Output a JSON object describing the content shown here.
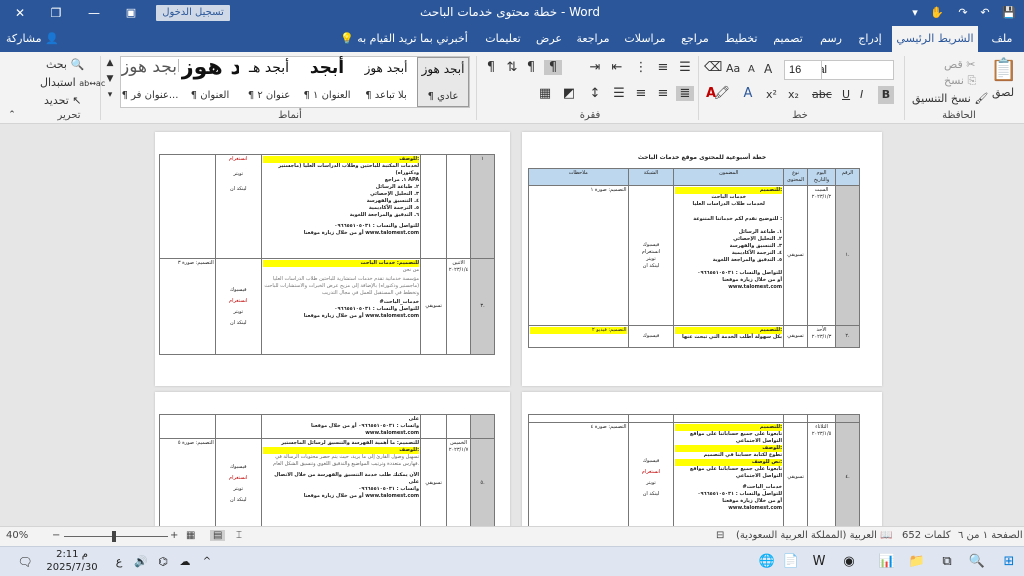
{
  "window": {
    "title": "خطة محتوى خدمات الباحث - Word",
    "signin_label": "تسجيل الدخول",
    "minimize": "—",
    "restore": "❐",
    "close": "✕"
  },
  "tabs": [
    "ملف",
    "الشريط الرئيسي",
    "إدراج",
    "رسم",
    "تصميم",
    "تخطيط",
    "مراجع",
    "مراسلات",
    "مراجعة",
    "عرض",
    "تعليمات"
  ],
  "tell_me": "أخبرني بما تريد القيام به",
  "share_label": "مشاركة",
  "clipboard": {
    "paste": "لصق",
    "cut": "قص",
    "copy": "نسخ",
    "format_painter": "نسخ التنسيق",
    "label": "الحافظة"
  },
  "font": {
    "name": "Arial",
    "size": "16",
    "label": "خط",
    "bold": "B",
    "italic": "I",
    "underline": "U",
    "strike": "abc",
    "sub": "x₂",
    "sup": "x²",
    "aa": "Aa",
    "grow": "A",
    "shrink": "A"
  },
  "paragraph": {
    "label": "فقرة"
  },
  "styles": {
    "label": "أنماط",
    "items": [
      {
        "sample": "أبجد هوز",
        "name": "¶ عادي"
      },
      {
        "sample": "أبجد هوز",
        "name": "¶ بلا تباعد"
      },
      {
        "sample": "أبجد",
        "name": "¶ العنوان ١"
      },
      {
        "sample": "أبجد هـ",
        "name": "¶ عنوان ٢"
      },
      {
        "sample": "أبجد هوز",
        "name": "¶ العنوان"
      },
      {
        "sample": "ابجد هوز",
        "name": "¶ عنوان فر..."
      }
    ]
  },
  "editing": {
    "find": "بحث",
    "replace": "استبدال",
    "select": "تحديد",
    "label": "تحرير"
  },
  "doc": {
    "page_title": "خطة أسبوعية للمحتوى موقع خدمات الباحث",
    "headers": [
      "الرقم",
      "اليوم والتاريخ",
      "نوع المحتوى",
      "المضمون",
      "الشبكة",
      "ملاحظات"
    ],
    "rows": [
      {
        "num": "١.",
        "day": "السبت",
        "date": "٢٠٢٣/١/٢",
        "type": "تسويقي",
        "content": [
          "للتصميم:",
          "خدمات الباحث",
          "لخدمات طلاب الدراسات العليا",
          "للتوضيح نقدم لكم خدماتنا المتنوعة :",
          "١. طباعة الرسائل",
          "٢. التحليل الإحصائي",
          "٣. التنسيق والفهرسة",
          "٤. الترجمة الأكاديمية",
          "٥. التدقيق والمراجعة اللغوية",
          "للتواصل والتساب : ٠٩٦٦٥٥١٠٥٠٣١",
          "أو من خلال زيارة موقعنا www.talomest.com"
        ],
        "networks": [
          "فيسبوك",
          "انستغرام",
          "تويتر",
          "لينكد ان"
        ],
        "notes": "التصميم: صورة ١"
      },
      {
        "num": "٢.",
        "day": "الأحد",
        "date": "٢٠٢٣/١/٣",
        "type": "تسويقي",
        "content": [
          "للتصميم:",
          "بكل سهولة أطلب الخدمة التي تبحث عنها"
        ],
        "networks": [
          "فيسبوك"
        ],
        "notes": "التصميم: فيديو ٢"
      },
      {
        "num": "٣.",
        "day": "الاثنين",
        "date": "٢٠٢٣/١/٤",
        "type": "تسويقي",
        "content": [
          "للتصميم: خدمات الباحث",
          "من نحن",
          "مؤسسة خدماتية تقدم خدمات استشارية للباحثين طلاب الدراسات العليا (ماجستير ودكتوراه) بالإضافة إلى مزيج عرض الخبرات والاستشارات للباحث وتخطط في المستقبل للعمل في مجال التدريب",
          "#خدمات_الباحث",
          "للتواصل والتساب : ٠٩٦٦٥٥١٠٥٠٣١",
          "أو من خلال زيارة موقعنا www.talomest.com"
        ],
        "networks": [
          "فيسبوك",
          "انستغرام",
          "تويتر",
          "لينكد ان"
        ],
        "notes": "التصميم: صورة ٣"
      },
      {
        "num": "٤.",
        "day": "الثلاثاء",
        "date": "٢٠٢٣/١/٥",
        "type": "تسويقي",
        "content": [
          "للتصميم:",
          "تابعونا على جميع حساباتنا على مواقع التواصل الاجتماعي",
          "للوصف:",
          "تطوع لكتابة حسابنا في التصميم",
          "نص للوصف:",
          "تابعونا على جميع حساباتنا على مواقع التواصل الاجتماعي",
          "#خدمات_الباحث",
          "للتواصل والتساب : ٠٩٦٦٥٥١٠٥٠٣١",
          "أو من خلال زيارة موقعنا www.talomest.com"
        ],
        "networks": [
          "فيسبوك",
          "انستغرام",
          "تويتر",
          "لينكد ان"
        ],
        "notes": "التصميم: صورة ٤"
      },
      {
        "num": "٥.",
        "day": "الخميس",
        "date": "٢٠٢٣/١/٧",
        "type": "تسويقي",
        "content": [
          "للتصميم: ما أهمية الفهرسة والتنسيق لرسائل الماجستير",
          "للوصف:",
          "تسهيل وصول القارئ إلى ما يريد، حيث يتم حصر محتويات الرسالة في فهارس متعددة وترتيب المواضيع والتدقيق اللغوي وتنسيق الشكل العام.",
          "الآن يمكنك طلب خدمة التنسيق والفهرسة من خلال الاتصال على",
          "واتساب : ٠٩٦٦٥٥١٠٥٠٣١",
          "أو من خلال زيارة موقعنا www.talomest.com"
        ],
        "networks": [
          "فيسبوك",
          "انستغرام",
          "تويتر",
          "لينكد ان"
        ],
        "notes": "التصميم: صورة ٥"
      }
    ],
    "page2_top": {
      "content": [
        "للوصف:",
        "لخدمات المكتبة للباحثين وطلاب الدراسات العليا (ماجستير ودكتوراه)",
        "١. مراجع APA",
        "٢. طباعة الرسائل",
        "٣. التحليل الإحصائي",
        "٤. التنسيق والفهرسة",
        "٥. الترجمة الأكاديمية",
        "٦. التدقيق والمراجعة اللغوية",
        "للتواصل والتساب : ٠٩٦٦٥٥١٠٥٠٣١",
        "أو من خلال زيارة موقعنا www.talomest.com"
      ],
      "networks": [
        "انستغرام",
        "تويتر",
        "لينكد ان"
      ]
    },
    "page4_top": [
      "على",
      "واتساب : ٠٩٦٦٥٥١٠٥٠٣١ أو من خلال موقعنا",
      "www.talomest.com"
    ]
  },
  "status": {
    "page": "الصفحة ١ من ٦",
    "words": "652 كلمات",
    "language": "العربية (المملكة العربية السعودية)",
    "zoom": "40%",
    "zoom_minus": "−",
    "zoom_plus": "+"
  },
  "taskbar": {
    "time": "2:11 م",
    "date": "2025/7/30",
    "lang": "ع"
  },
  "colors": {
    "accent": "#2b579a",
    "ribbon": "#f3f3f3",
    "header_cell": "#bdd7ee"
  }
}
